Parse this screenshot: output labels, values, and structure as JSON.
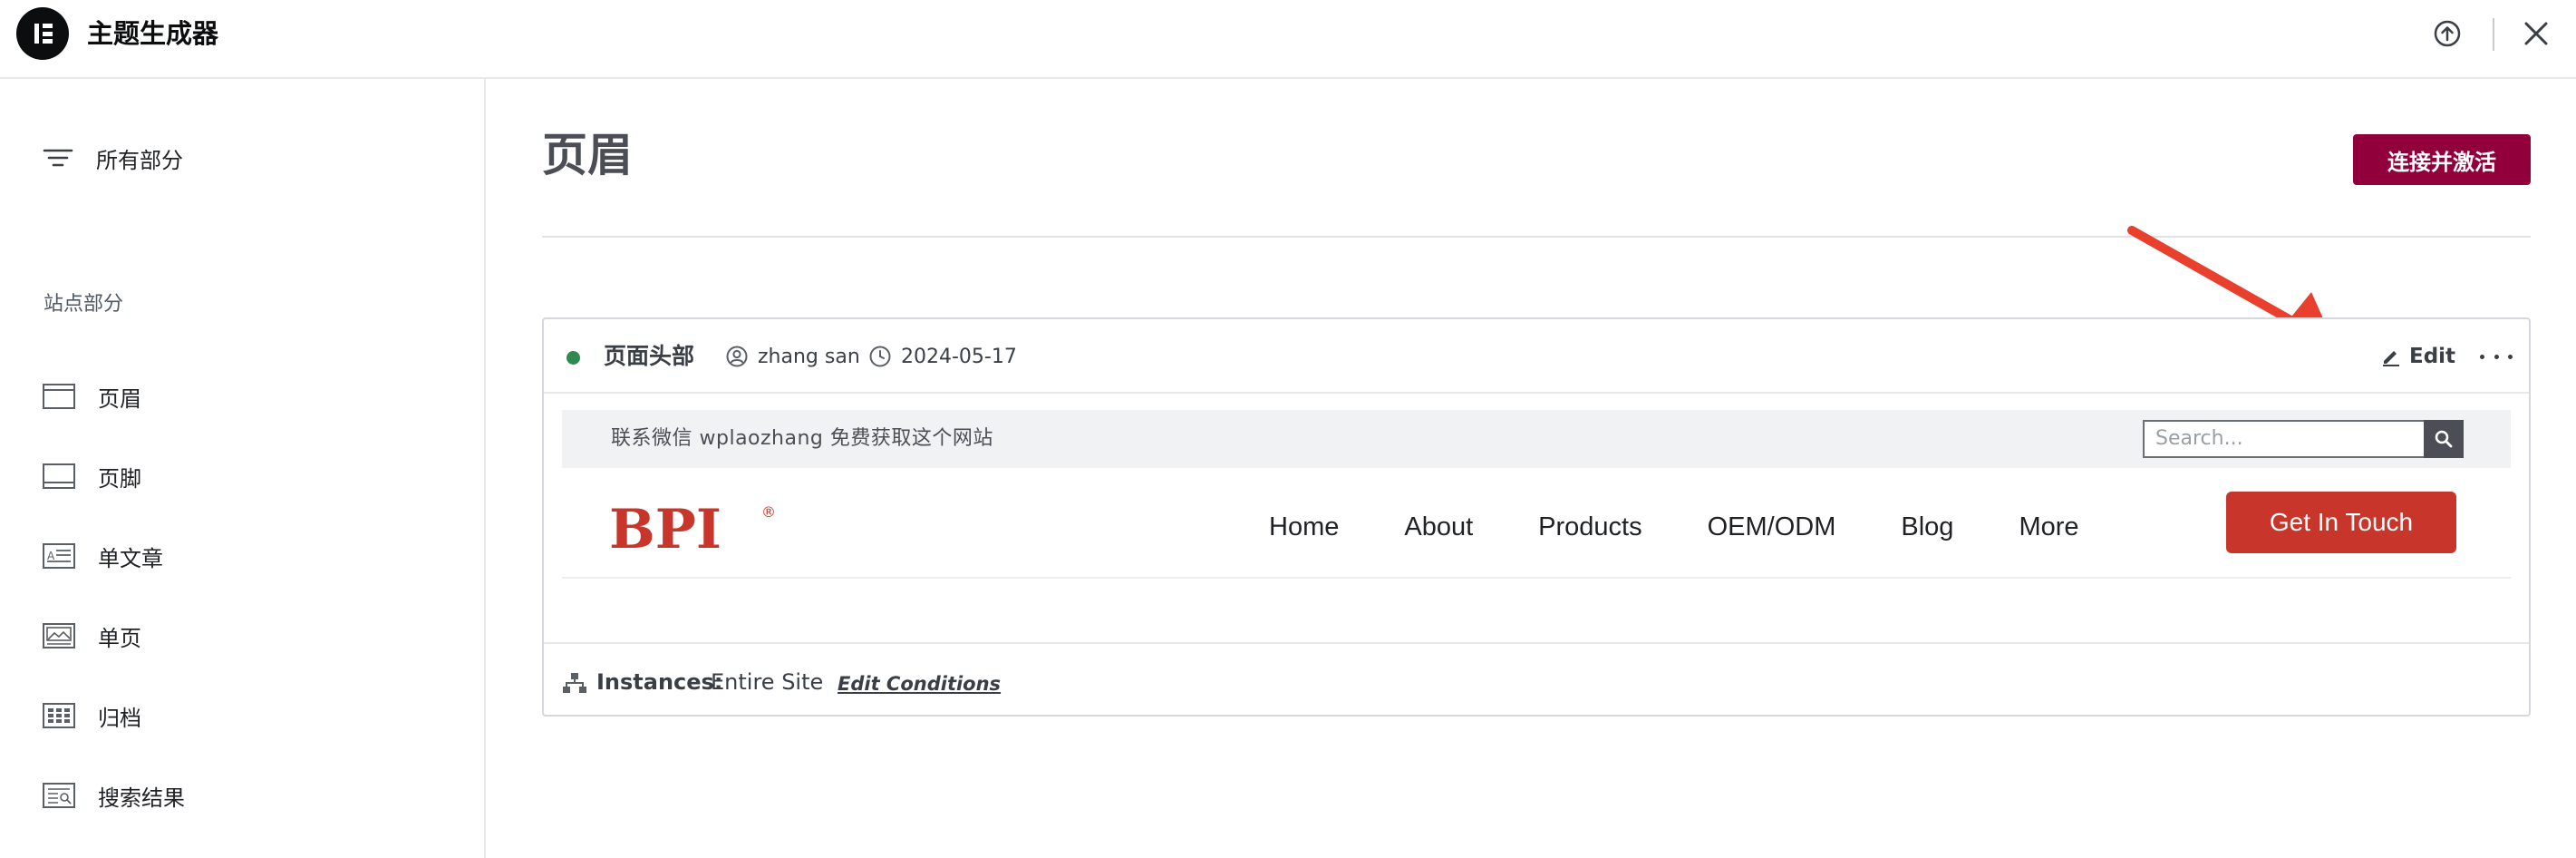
{
  "app": {
    "title": "主题生成器"
  },
  "sidebar": {
    "all_label": "所有部分",
    "section_title": "站点部分",
    "items": [
      {
        "label": "页眉",
        "icon": "header-icon"
      },
      {
        "label": "页脚",
        "icon": "footer-icon"
      },
      {
        "label": "单文章",
        "icon": "single-post-icon"
      },
      {
        "label": "单页",
        "icon": "single-page-icon"
      },
      {
        "label": "归档",
        "icon": "archive-icon"
      },
      {
        "label": "搜索结果",
        "icon": "search-results-icon"
      }
    ]
  },
  "main": {
    "title": "页眉",
    "connect_label": "连接并激活",
    "card": {
      "name": "页面头部",
      "author": "zhang san",
      "date": "2024-05-17",
      "edit_label": "Edit",
      "status_color": "#2f8a4f",
      "preview": {
        "topbar_text": "联系微信 wplaozhang 免费获取这个网站",
        "search_placeholder": "Search...",
        "logo_text": "BPI",
        "logo_mark": "®",
        "nav": [
          "Home",
          "About",
          "Products",
          "OEM/ODM",
          "Blog",
          "More"
        ],
        "cta_label": "Get In Touch",
        "cta_color": "#c8362b",
        "brand_color": "#c8362b"
      },
      "instances_label": "Instances:",
      "instances_value": "Entire Site",
      "edit_conditions_label": "Edit Conditions"
    }
  },
  "colors": {
    "accent": "#92003b",
    "arrow": "#e8402d"
  }
}
